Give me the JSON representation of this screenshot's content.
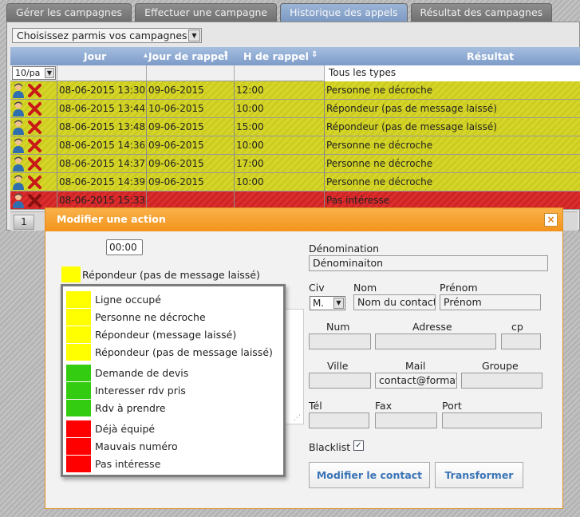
{
  "tabs": [
    "Gérer les campagnes",
    "Effectuer une campagne",
    "Historique des appels",
    "Résultat des campagnes"
  ],
  "campaign_select": "Choisissez parmis vos campagnes",
  "grid": {
    "headers": {
      "jour": "Jour",
      "jour_rappel": "Jour de rappel",
      "h_rappel": "H de rappel",
      "resultat": "Résultat"
    },
    "per_page": "10/pa",
    "type_filter": "Tous les types",
    "rows": [
      {
        "jour": "08-06-2015 13:30",
        "jour_rappel": "09-06-2015",
        "h_rappel": "12:00",
        "resultat": "Personne ne décroche",
        "color": "yellow"
      },
      {
        "jour": "08-06-2015 13:44",
        "jour_rappel": "10-06-2015",
        "h_rappel": "10:00",
        "resultat": "Répondeur (pas de message laissé)",
        "color": "yellow"
      },
      {
        "jour": "08-06-2015 13:48",
        "jour_rappel": "09-06-2015",
        "h_rappel": "15:00",
        "resultat": "Répondeur (pas de message laissé)",
        "color": "yellow"
      },
      {
        "jour": "08-06-2015 14:36",
        "jour_rappel": "09-06-2015",
        "h_rappel": "10:00",
        "resultat": "Personne ne décroche",
        "color": "yellow"
      },
      {
        "jour": "08-06-2015 14:37",
        "jour_rappel": "09-06-2015",
        "h_rappel": "17:00",
        "resultat": "Personne ne décroche",
        "color": "yellow"
      },
      {
        "jour": "08-06-2015 14:39",
        "jour_rappel": "09-06-2015",
        "h_rappel": "10:00",
        "resultat": "Personne ne décroche",
        "color": "yellow"
      },
      {
        "jour": "08-06-2015 15:33",
        "jour_rappel": "",
        "h_rappel": "",
        "resultat": "Pas intéresse",
        "color": "red"
      }
    ],
    "page": "1"
  },
  "modal": {
    "title": "Modifier une action",
    "close": "×",
    "time": "00:00",
    "current_status": "Répondeur (pas de message laissé)",
    "status_options": [
      {
        "label": "Ligne occupé",
        "color": "#ffff00"
      },
      {
        "label": "Personne ne décroche",
        "color": "#ffff00"
      },
      {
        "label": "Répondeur (message laissé)",
        "color": "#ffff00"
      },
      {
        "label": "Répondeur (pas de message laissé)",
        "color": "#ffff00"
      },
      {
        "label": "Demande de devis",
        "color": "#33cc11"
      },
      {
        "label": "Interesser rdv pris",
        "color": "#33cc11"
      },
      {
        "label": "Rdv à prendre",
        "color": "#33cc11"
      },
      {
        "label": "Déjà équipé",
        "color": "#ff0000"
      },
      {
        "label": "Mauvais numéro",
        "color": "#ff0000"
      },
      {
        "label": "Pas intéresse",
        "color": "#ff0000"
      }
    ],
    "form": {
      "denomination_label": "Dénomination",
      "denomination_value": "Dénominaiton",
      "civ_label": "Civ",
      "civ_value": "M.",
      "nom_label": "Nom",
      "nom_value": "Nom du contact",
      "prenom_label": "Prénom",
      "prenom_value": "Prénom",
      "num_label": "Num",
      "adresse_label": "Adresse",
      "cp_label": "cp",
      "ville_label": "Ville",
      "mail_label": "Mail",
      "mail_value": "contact@format",
      "groupe_label": "Groupe",
      "tel_label": "Tél",
      "fax_label": "Fax",
      "port_label": "Port",
      "blacklist_label": "Blacklist",
      "blacklist_checked": "✓",
      "modify_button": "Modifier le contact",
      "transform_button": "Transformer"
    }
  },
  "colors": {
    "yellow_row": "#d6d62a",
    "red_row": "#dc2e2e",
    "modal_header": "#f5a030",
    "grid_header": "#8ba8d0"
  }
}
